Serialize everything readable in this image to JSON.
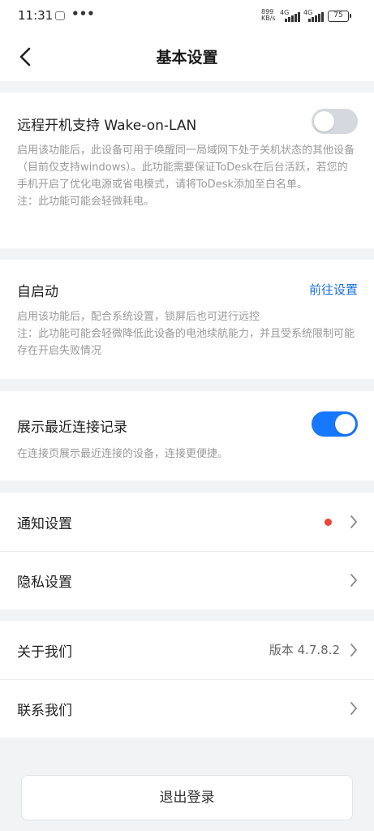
{
  "status_bar": {
    "time": "11:31",
    "dots": "•••",
    "speed_value": "899",
    "speed_unit": "KB/s",
    "signal1": "4G",
    "signal2": "4G",
    "battery": "75"
  },
  "nav": {
    "title": "基本设置"
  },
  "wake_on_lan": {
    "title": "远程开机支持 Wake-on-LAN",
    "description": "启用该功能后，此设备可用于唤醒同一局域网下处于关机状态的其他设备（目前仅支持windows）。此功能需要保证ToDesk在后台活跃，若您的手机开启了优化电源或省电模式，请将ToDesk添加至白名单。",
    "note": "注：此功能可能会轻微耗电。",
    "enabled": false
  },
  "auto_start": {
    "title": "自启动",
    "link": "前往设置",
    "description": "启用该功能后，配合系统设置，锁屏后也可进行远控",
    "note": "注：此功能可能会轻微降低此设备的电池续航能力，并且受系统限制可能存在开启失败情况"
  },
  "recent_connections": {
    "title": "展示最近连接记录",
    "description": "在连接页展示最近连接的设备，连接更便捷。",
    "enabled": true
  },
  "list": {
    "notification": "通知设置",
    "privacy": "隐私设置",
    "about": "关于我们",
    "version": "版本 4.7.8.2",
    "contact": "联系我们"
  },
  "logout": "退出登录",
  "colors": {
    "accent": "#1677ff",
    "link": "#1a6fe0",
    "badge": "#f0433a",
    "background": "#f2f3f5"
  }
}
